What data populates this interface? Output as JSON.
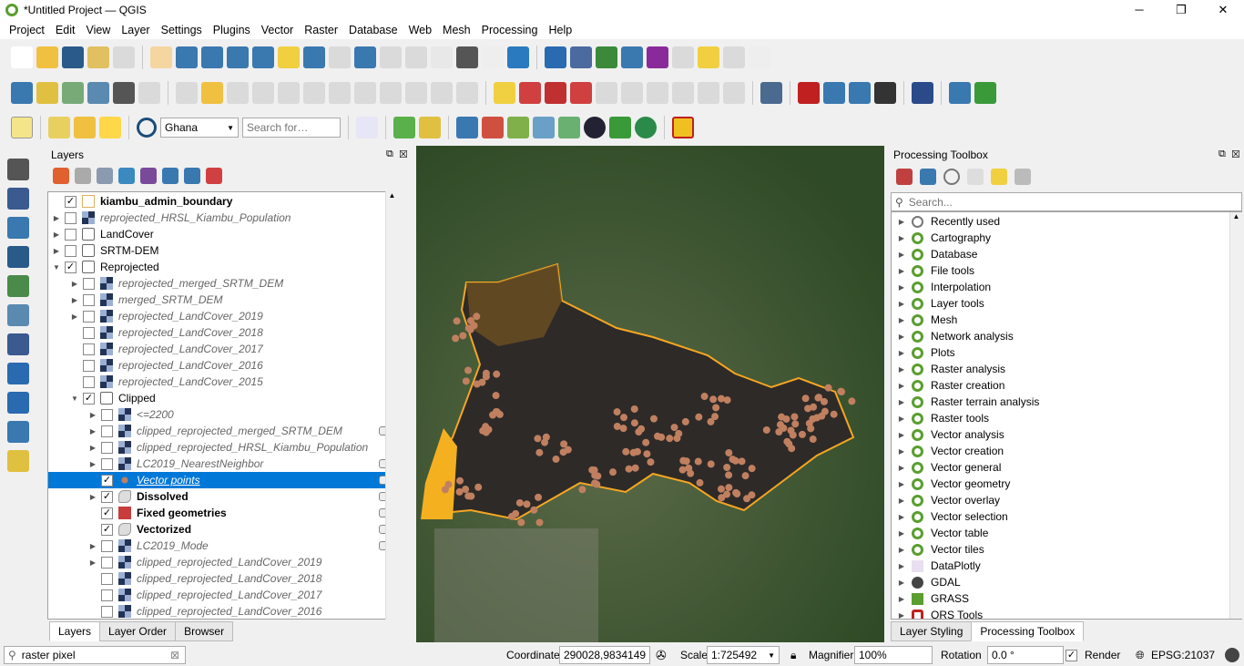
{
  "window": {
    "title": "*Untitled Project — QGIS"
  },
  "menu": [
    "Project",
    "Edit",
    "View",
    "Layer",
    "Settings",
    "Plugins",
    "Vector",
    "Raster",
    "Database",
    "Web",
    "Mesh",
    "Processing",
    "Help"
  ],
  "toolbar": {
    "locator_combo": "Ghana",
    "search_placeholder": "Search for…"
  },
  "layers_panel": {
    "title": "Layers",
    "tabs": [
      "Layers",
      "Layer Order",
      "Browser"
    ],
    "active_tab": "Layers",
    "items": [
      {
        "label": "kiambu_admin_boundary",
        "level": 0,
        "exp": "",
        "checked": true,
        "icon": "polygon",
        "style": "bold"
      },
      {
        "label": "reprojected_HRSL_Kiambu_Population",
        "level": 0,
        "exp": "right",
        "checked": false,
        "icon": "raster",
        "style": "ital"
      },
      {
        "label": "LandCover",
        "level": 0,
        "exp": "right",
        "checked": false,
        "icon": "group",
        "style": ""
      },
      {
        "label": "SRTM-DEM",
        "level": 0,
        "exp": "right",
        "checked": false,
        "icon": "group",
        "style": ""
      },
      {
        "label": "Reprojected",
        "level": 0,
        "exp": "down",
        "checked": true,
        "icon": "group",
        "style": ""
      },
      {
        "label": "reprojected_merged_SRTM_DEM",
        "level": 1,
        "exp": "right",
        "checked": false,
        "icon": "raster",
        "style": "ital"
      },
      {
        "label": "merged_SRTM_DEM",
        "level": 1,
        "exp": "right",
        "checked": false,
        "icon": "raster",
        "style": "ital"
      },
      {
        "label": "reprojected_LandCover_2019",
        "level": 1,
        "exp": "right",
        "checked": false,
        "icon": "raster",
        "style": "ital"
      },
      {
        "label": "reprojected_LandCover_2018",
        "level": 1,
        "exp": "",
        "checked": false,
        "icon": "raster",
        "style": "ital"
      },
      {
        "label": "reprojected_LandCover_2017",
        "level": 1,
        "exp": "",
        "checked": false,
        "icon": "raster",
        "style": "ital"
      },
      {
        "label": "reprojected_LandCover_2016",
        "level": 1,
        "exp": "",
        "checked": false,
        "icon": "raster",
        "style": "ital"
      },
      {
        "label": "reprojected_LandCover_2015",
        "level": 1,
        "exp": "",
        "checked": false,
        "icon": "raster",
        "style": "ital"
      },
      {
        "label": "Clipped",
        "level": 1,
        "exp": "down",
        "checked": true,
        "icon": "group",
        "style": ""
      },
      {
        "label": "<=2200",
        "level": 2,
        "exp": "right",
        "checked": false,
        "icon": "raster",
        "style": "ital"
      },
      {
        "label": "clipped_reprojected_merged_SRTM_DEM",
        "level": 2,
        "exp": "right",
        "checked": false,
        "icon": "raster",
        "style": "ital",
        "mem": true
      },
      {
        "label": "clipped_reprojected_HRSL_Kiambu_Population",
        "level": 2,
        "exp": "right",
        "checked": false,
        "icon": "raster",
        "style": "ital"
      },
      {
        "label": "LC2019_NearestNeighbor",
        "level": 2,
        "exp": "right",
        "checked": false,
        "icon": "raster",
        "style": "ital",
        "mem": true
      },
      {
        "label": "Vector points",
        "level": 2,
        "exp": "",
        "checked": true,
        "icon": "point",
        "style": "ital",
        "selected": true,
        "mem": true
      },
      {
        "label": "Dissolved",
        "level": 2,
        "exp": "right",
        "checked": true,
        "icon": "polygon-gray",
        "style": "bold",
        "mem": true
      },
      {
        "label": "Fixed geometries",
        "level": 2,
        "exp": "",
        "checked": true,
        "icon": "polygon-red",
        "style": "bold",
        "mem": true
      },
      {
        "label": "Vectorized",
        "level": 2,
        "exp": "",
        "checked": true,
        "icon": "polygon-gray",
        "style": "bold",
        "mem": true
      },
      {
        "label": "LC2019_Mode",
        "level": 2,
        "exp": "right",
        "checked": false,
        "icon": "raster",
        "style": "ital",
        "mem": true
      },
      {
        "label": "clipped_reprojected_LandCover_2019",
        "level": 2,
        "exp": "right",
        "checked": false,
        "icon": "raster",
        "style": "ital"
      },
      {
        "label": "clipped_reprojected_LandCover_2018",
        "level": 2,
        "exp": "",
        "checked": false,
        "icon": "raster",
        "style": "ital"
      },
      {
        "label": "clipped_reprojected_LandCover_2017",
        "level": 2,
        "exp": "",
        "checked": false,
        "icon": "raster",
        "style": "ital"
      },
      {
        "label": "clipped_reprojected_LandCover_2016",
        "level": 2,
        "exp": "",
        "checked": false,
        "icon": "raster",
        "style": "ital"
      }
    ]
  },
  "processing": {
    "title": "Processing Toolbox",
    "search_placeholder": "Search...",
    "tabs": [
      "Layer Styling",
      "Processing Toolbox"
    ],
    "active_tab": "Processing Toolbox",
    "items": [
      {
        "label": "Recently used",
        "icon": "clock"
      },
      {
        "label": "Cartography",
        "icon": "qgis"
      },
      {
        "label": "Database",
        "icon": "qgis"
      },
      {
        "label": "File tools",
        "icon": "qgis"
      },
      {
        "label": "Interpolation",
        "icon": "qgis"
      },
      {
        "label": "Layer tools",
        "icon": "qgis"
      },
      {
        "label": "Mesh",
        "icon": "qgis"
      },
      {
        "label": "Network analysis",
        "icon": "qgis"
      },
      {
        "label": "Plots",
        "icon": "qgis"
      },
      {
        "label": "Raster analysis",
        "icon": "qgis"
      },
      {
        "label": "Raster creation",
        "icon": "qgis"
      },
      {
        "label": "Raster terrain analysis",
        "icon": "qgis"
      },
      {
        "label": "Raster tools",
        "icon": "qgis"
      },
      {
        "label": "Vector analysis",
        "icon": "qgis"
      },
      {
        "label": "Vector creation",
        "icon": "qgis"
      },
      {
        "label": "Vector general",
        "icon": "qgis"
      },
      {
        "label": "Vector geometry",
        "icon": "qgis"
      },
      {
        "label": "Vector overlay",
        "icon": "qgis"
      },
      {
        "label": "Vector selection",
        "icon": "qgis"
      },
      {
        "label": "Vector table",
        "icon": "qgis"
      },
      {
        "label": "Vector tiles",
        "icon": "qgis"
      },
      {
        "label": "DataPlotly",
        "icon": "chart"
      },
      {
        "label": "GDAL",
        "icon": "gdal"
      },
      {
        "label": "GRASS",
        "icon": "grass"
      },
      {
        "label": "ORS Tools",
        "icon": "ors"
      }
    ]
  },
  "status": {
    "locator_value": "raster pixel",
    "coordinate_label": "Coordinate",
    "coordinate": "290028,9834149",
    "scale_label": "Scale",
    "scale": "1:725492",
    "magnifier_label": "Magnifier",
    "magnifier": "100%",
    "rotation_label": "Rotation",
    "rotation": "0.0 °",
    "render_label": "Render",
    "render_checked": true,
    "crs": "EPSG:21037"
  },
  "colors": {
    "selection": "#0078d7",
    "boundary": "#f5a623",
    "fill": "#2e2a28",
    "points": "#c08060"
  }
}
